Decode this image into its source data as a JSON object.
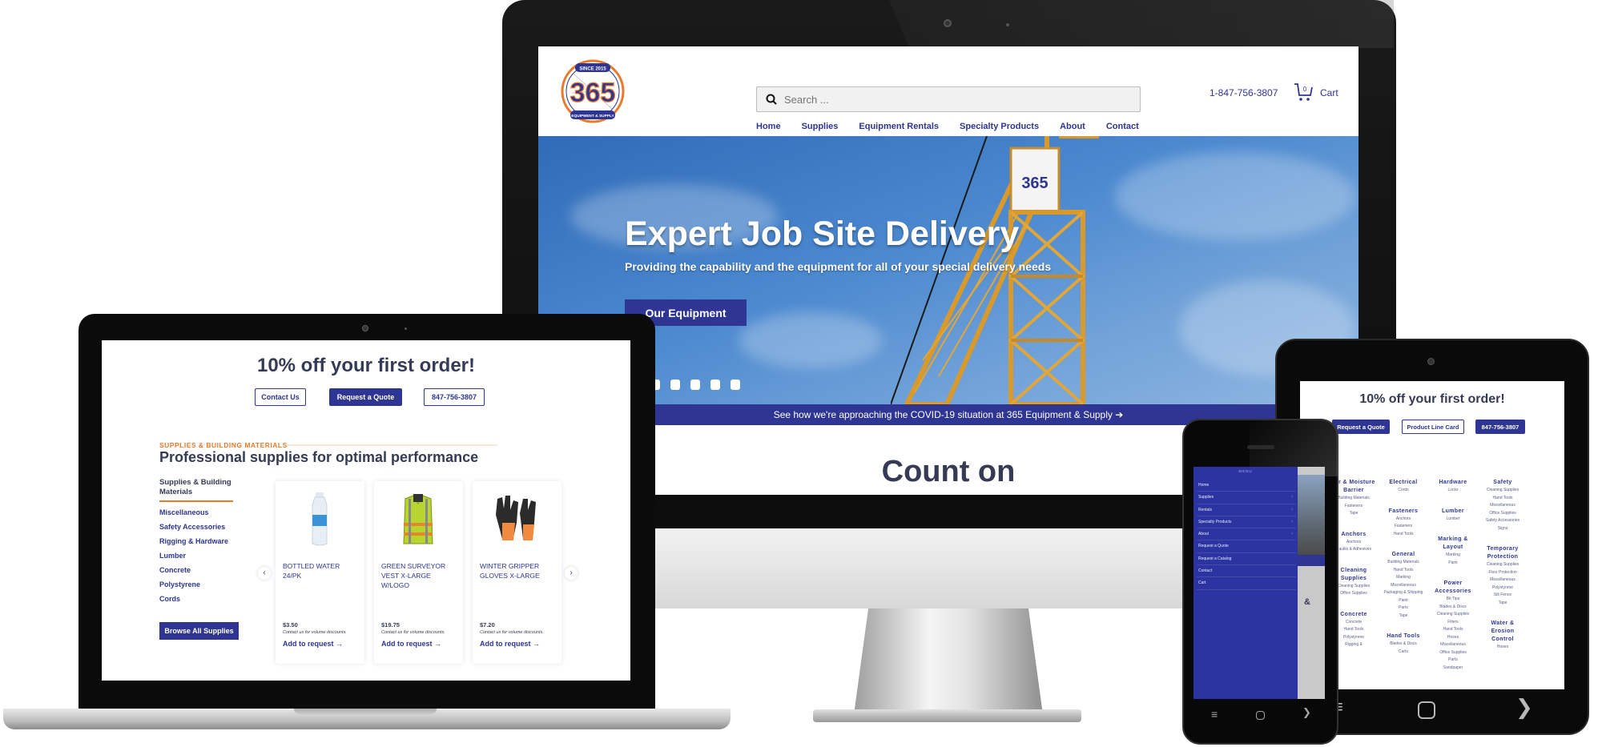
{
  "desktop": {
    "logo": {
      "top_text": "SINCE 2015",
      "number": "365",
      "bottom_text": "EQUIPMENT & SUPPLY"
    },
    "search": {
      "placeholder": "Search ..."
    },
    "nav": [
      {
        "label": "Home",
        "active": true
      },
      {
        "label": "Supplies",
        "active": false
      },
      {
        "label": "Equipment Rentals",
        "active": false
      },
      {
        "label": "Specialty Products",
        "active": false
      },
      {
        "label": "About",
        "active": false
      },
      {
        "label": "Contact",
        "active": false
      }
    ],
    "phone": "1-847-756-3807",
    "cart": {
      "label": "Cart",
      "count": "0"
    },
    "hero": {
      "title": "Expert Job Site Delivery",
      "subtitle": "Providing the capability and the equipment for all of your special delivery needs",
      "button": "Our Equipment",
      "slides": 5
    },
    "covid_banner": "See how we're approaching the COVID-19 situation at 365 Equipment & Supply ➔",
    "section_heading": "Count on"
  },
  "laptop": {
    "offer": "10% off your first order!",
    "buttons": [
      "Contact Us",
      "Request a Quote",
      "847-756-3807"
    ],
    "eyebrow": "SUPPLIES & BUILDING MATERIALS",
    "heading": "Professional supplies for optimal performance",
    "active_category": "Supplies & Building Materials",
    "categories": [
      "Miscellaneous",
      "Safety Accessories",
      "Rigging & Hardware",
      "Lumber",
      "Concrete",
      "Polystyrene",
      "Cords"
    ],
    "browse_button": "Browse All Supplies",
    "products": [
      {
        "name": "BOTTLED WATER 24/PK",
        "price": "$3.50",
        "note": "Contact us for volume discounts.",
        "cta": "Add to request →",
        "image": "water-bottle"
      },
      {
        "name": "GREEN SURVEYOR VEST X-LARGE W/LOGO",
        "price": "$19.75",
        "note": "Contact us for volume discounts.",
        "cta": "Add to request →",
        "image": "safety-vest"
      },
      {
        "name": "WINTER GRIPPER GLOVES X-LARGE",
        "price": "$7.20",
        "note": "Contact us for volume discounts.",
        "cta": "Add to request →",
        "image": "gloves"
      }
    ],
    "prev_arrow": "‹",
    "next_arrow": "›"
  },
  "tablet": {
    "offer": "10% off your first order!",
    "buttons": [
      "Request a Quote",
      "Product Line Card",
      "847-756-3807"
    ],
    "columns": [
      [
        {
          "title": "Air & Moisture Barrier",
          "links": [
            "Building Materials",
            "Fasteners",
            "Tape"
          ]
        },
        {
          "title": "Anchors",
          "links": [
            "Anchors",
            "Caulks & Adhesives"
          ]
        },
        {
          "title": "Cleaning Supplies",
          "links": [
            "Cleaning Supplies",
            "Office Supplies"
          ]
        },
        {
          "title": "Concrete",
          "links": [
            "Concrete",
            "Hand Tools",
            "Polystyrene",
            "Rigging &"
          ]
        }
      ],
      [
        {
          "title": "Electrical",
          "links": [
            "Cords"
          ]
        },
        {
          "title": "Fasteners",
          "links": [
            "Anchors",
            "Fasteners",
            "Hand Tools"
          ]
        },
        {
          "title": "General",
          "links": [
            "Building Materials",
            "Hand Tools",
            "Marking",
            "Miscellaneous",
            "Packaging & Shipping",
            "Paint",
            "Parts",
            "Tape"
          ]
        },
        {
          "title": "Hand Tools",
          "links": [
            "Blades & Discs",
            "Carts"
          ]
        }
      ],
      [
        {
          "title": "Hardware",
          "links": [
            "Locks"
          ]
        },
        {
          "title": "Lumber",
          "links": [
            "Lumber"
          ]
        },
        {
          "title": "Marking & Layout",
          "links": [
            "Marking",
            "Paint"
          ]
        },
        {
          "title": "Power Accessories",
          "links": [
            "Bit Tips",
            "Blades & Discs",
            "Cleaning Supplies",
            "Filters",
            "Hand Tools",
            "Hoses",
            "Miscellaneous",
            "Office Supplies",
            "Parts",
            "Sandpaper"
          ]
        }
      ],
      [
        {
          "title": "Safety",
          "links": [
            "Cleaning Supplies",
            "Hand Tools",
            "Miscellaneous",
            "Office Supplies",
            "Safety Accessories",
            "Signs"
          ]
        },
        {
          "title": "Temporary Protection",
          "links": [
            "Cleaning Supplies",
            "Floor Protection",
            "Miscellaneous",
            "Polystyrene",
            "Silt Fence",
            "Tape"
          ]
        },
        {
          "title": "Water & Erosion Control",
          "links": [
            "Hoses"
          ]
        }
      ]
    ],
    "nav_icons": [
      "menu-icon",
      "home-icon",
      "back-icon"
    ]
  },
  "phone": {
    "menu_title": "MENU",
    "menu_items": [
      {
        "label": "Home",
        "has_submenu": false
      },
      {
        "label": "Supplies",
        "has_submenu": true
      },
      {
        "label": "Rentals",
        "has_submenu": true
      },
      {
        "label": "Specialty Products",
        "has_submenu": true
      },
      {
        "label": "About",
        "has_submenu": true
      },
      {
        "label": "Request a Quote",
        "has_submenu": false
      },
      {
        "label": "Request a Catalog",
        "has_submenu": false
      },
      {
        "label": "Contact",
        "has_submenu": false
      },
      {
        "label": "Cart",
        "has_submenu": false
      }
    ],
    "peek_heading": "&",
    "nav_icons": [
      "menu-icon",
      "home-icon",
      "back-icon"
    ]
  },
  "colors": {
    "brand_navy": "#2e3592",
    "accent_orange": "#e87a2a",
    "heading_dark": "#363b55"
  }
}
